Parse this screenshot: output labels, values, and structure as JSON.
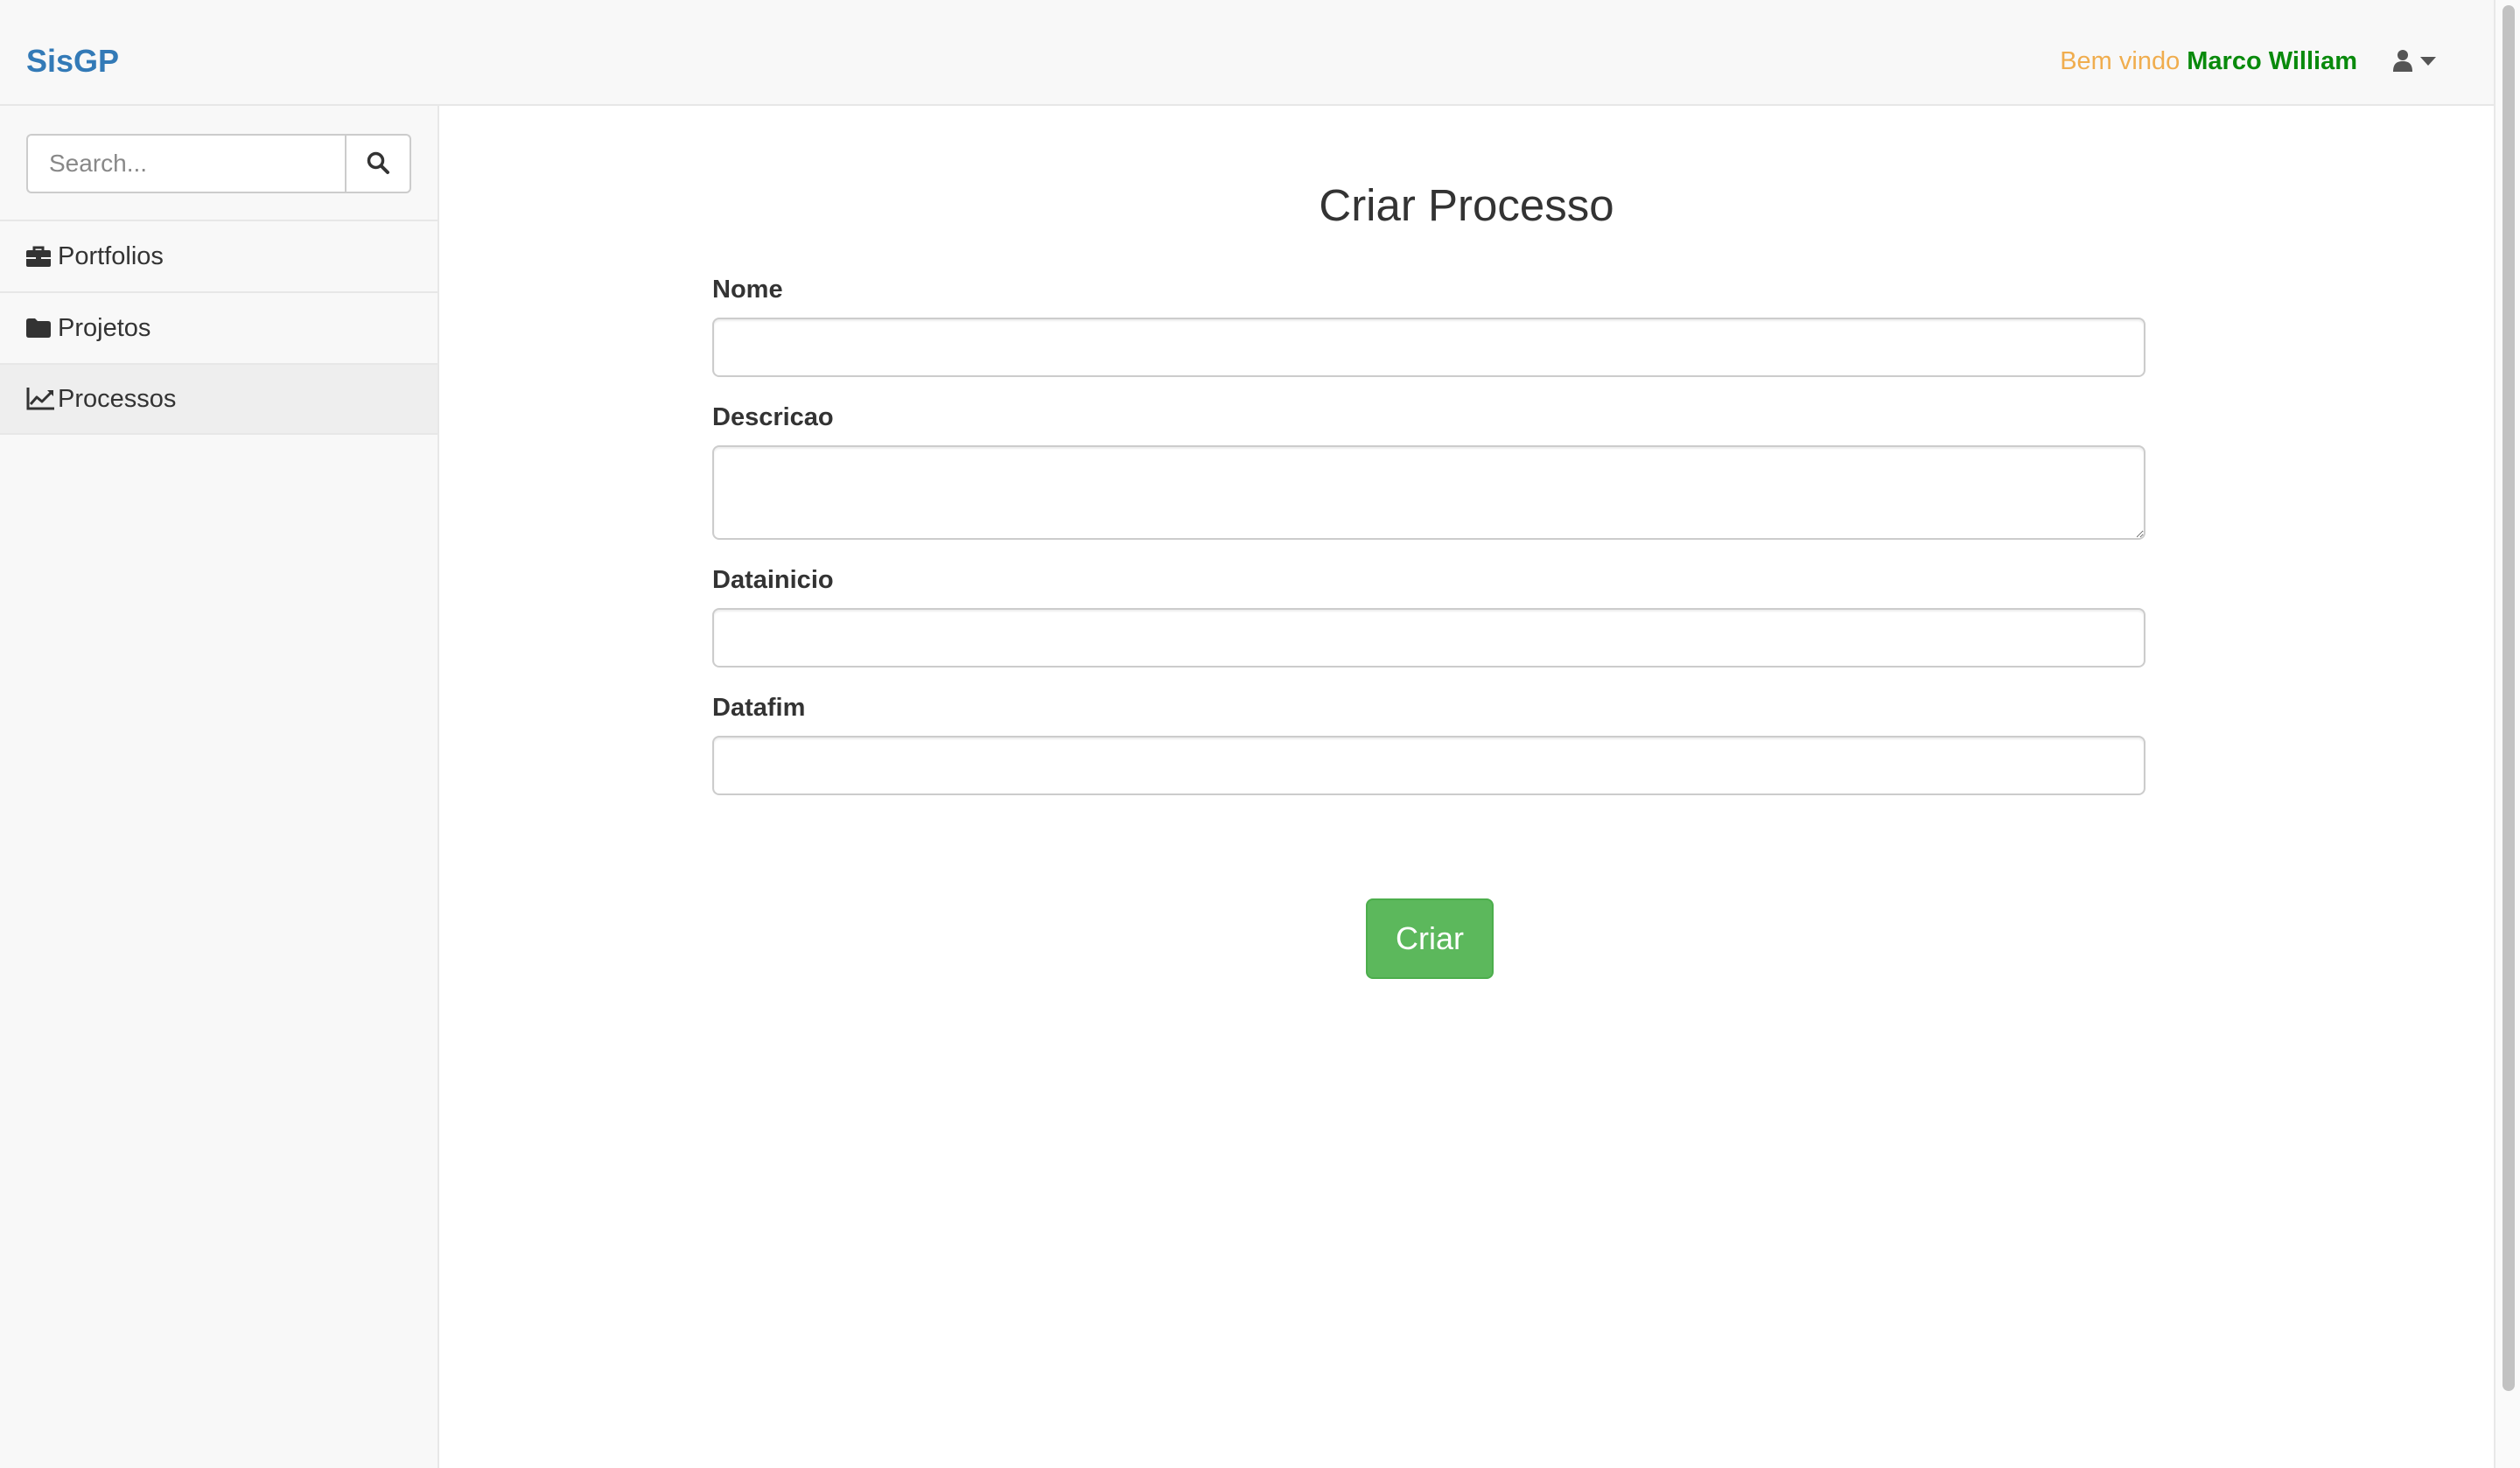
{
  "navbar": {
    "brand": "SisGP",
    "welcome_prefix": "Bem vindo",
    "user_name": "Marco William",
    "user_icon": "user-icon",
    "caret_icon": "caret-down-icon"
  },
  "sidebar": {
    "search": {
      "placeholder": "Search...",
      "value": "",
      "icon": "search-icon"
    },
    "items": [
      {
        "label": "Portfolios",
        "icon": "briefcase-icon",
        "active": false
      },
      {
        "label": "Projetos",
        "icon": "folder-icon",
        "active": false
      },
      {
        "label": "Processos",
        "icon": "line-chart-icon",
        "active": true
      }
    ]
  },
  "main": {
    "title": "Criar Processo",
    "fields": [
      {
        "label": "Nome",
        "value": ""
      },
      {
        "label": "Descricao",
        "value": ""
      },
      {
        "label": "Datainicio",
        "value": ""
      },
      {
        "label": "Datafim",
        "value": ""
      }
    ],
    "submit_label": "Criar"
  },
  "colors": {
    "brand": "#337ab7",
    "welcome": "#f0ad4e",
    "user_name": "#098a0c",
    "success_button": "#5cb85c"
  }
}
